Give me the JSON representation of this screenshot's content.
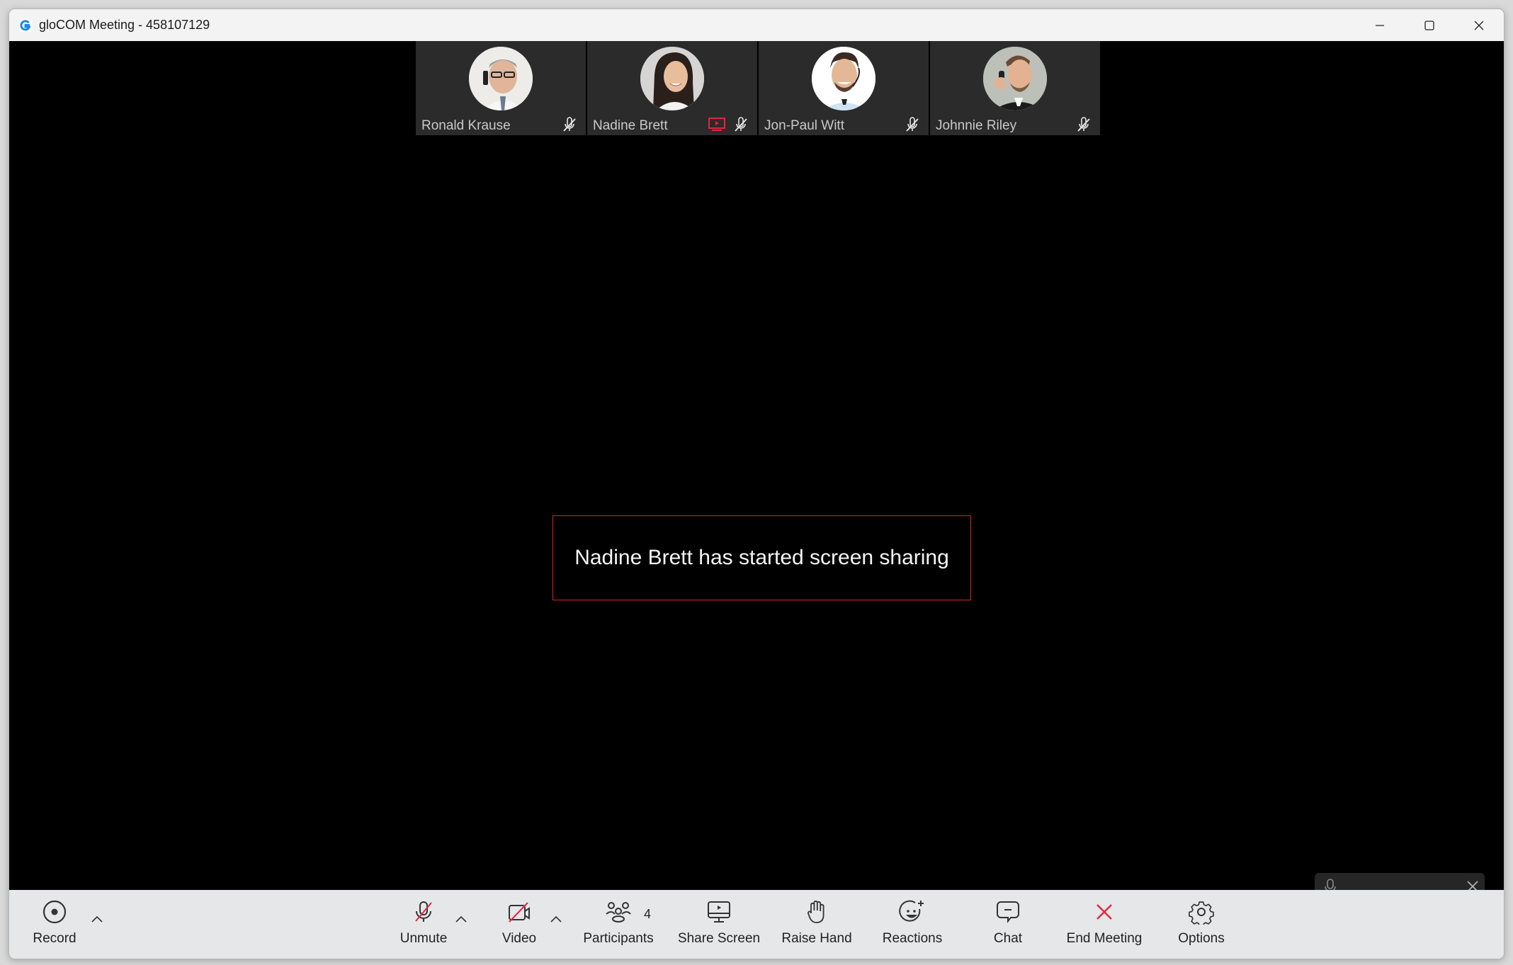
{
  "window": {
    "title": "gloCOM Meeting - 458107129",
    "controls": {
      "minimize": "minimize",
      "maximize": "maximize",
      "close": "close"
    }
  },
  "participants": [
    {
      "name": "Ronald Krause",
      "muted": true,
      "sharing": false,
      "avatar_bg": "#d8d4cf"
    },
    {
      "name": "Nadine Brett",
      "muted": true,
      "sharing": true,
      "avatar_bg": "#c9c6c3"
    },
    {
      "name": "Jon-Paul Witt",
      "muted": true,
      "sharing": false,
      "avatar_bg": "#f4f4f4"
    },
    {
      "name": "Johnnie Riley",
      "muted": true,
      "sharing": false,
      "avatar_bg": "#b9bab5"
    }
  ],
  "notification": {
    "text": "Nadine Brett has started screen sharing",
    "border_color": "#d9232d"
  },
  "toolbar": {
    "record": "Record",
    "unmute": "Unmute",
    "video": "Video",
    "participants": "Participants",
    "participants_count": "4",
    "share_screen": "Share Screen",
    "raise_hand": "Raise Hand",
    "reactions": "Reactions",
    "chat": "Chat",
    "end_meeting": "End Meeting",
    "options": "Options"
  },
  "colors": {
    "accent_red": "#e3263b",
    "brand_blue": "#1e88e5",
    "stage_bg": "#000000",
    "tile_bg": "#2b2b2b"
  }
}
